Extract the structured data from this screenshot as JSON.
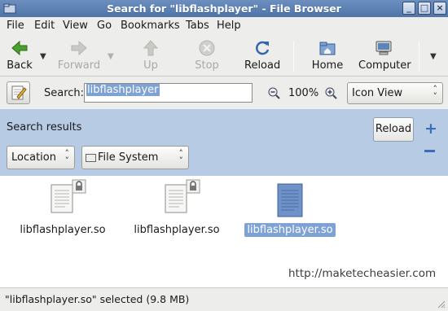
{
  "window": {
    "title": "Search for \"libflashplayer\" - File Browser"
  },
  "menu": [
    "File",
    "Edit",
    "View",
    "Go",
    "Bookmarks",
    "Tabs",
    "Help"
  ],
  "toolbar": {
    "back": "Back",
    "forward": "Forward",
    "up": "Up",
    "stop": "Stop",
    "reload": "Reload",
    "home": "Home",
    "computer": "Computer"
  },
  "search": {
    "label": "Search:",
    "value": "libflashplayer",
    "zoom": "100%",
    "view_mode": "Icon View"
  },
  "results": {
    "title": "Search results",
    "reload": "Reload",
    "location_label": "Location",
    "location_value": "File System"
  },
  "files": [
    {
      "name": "libflashplayer.so",
      "locked": true,
      "selected": false
    },
    {
      "name": "libflashplayer.so",
      "locked": true,
      "selected": false
    },
    {
      "name": "libflashplayer.so",
      "locked": false,
      "selected": true
    }
  ],
  "watermark": "http://maketecheasier.com",
  "status": "\"libflashplayer.so\" selected (9.8 MB)",
  "colors": {
    "titlebar": "#5a7fb3",
    "results_pane": "#b8cbe5",
    "selection": "#7da2d3"
  }
}
